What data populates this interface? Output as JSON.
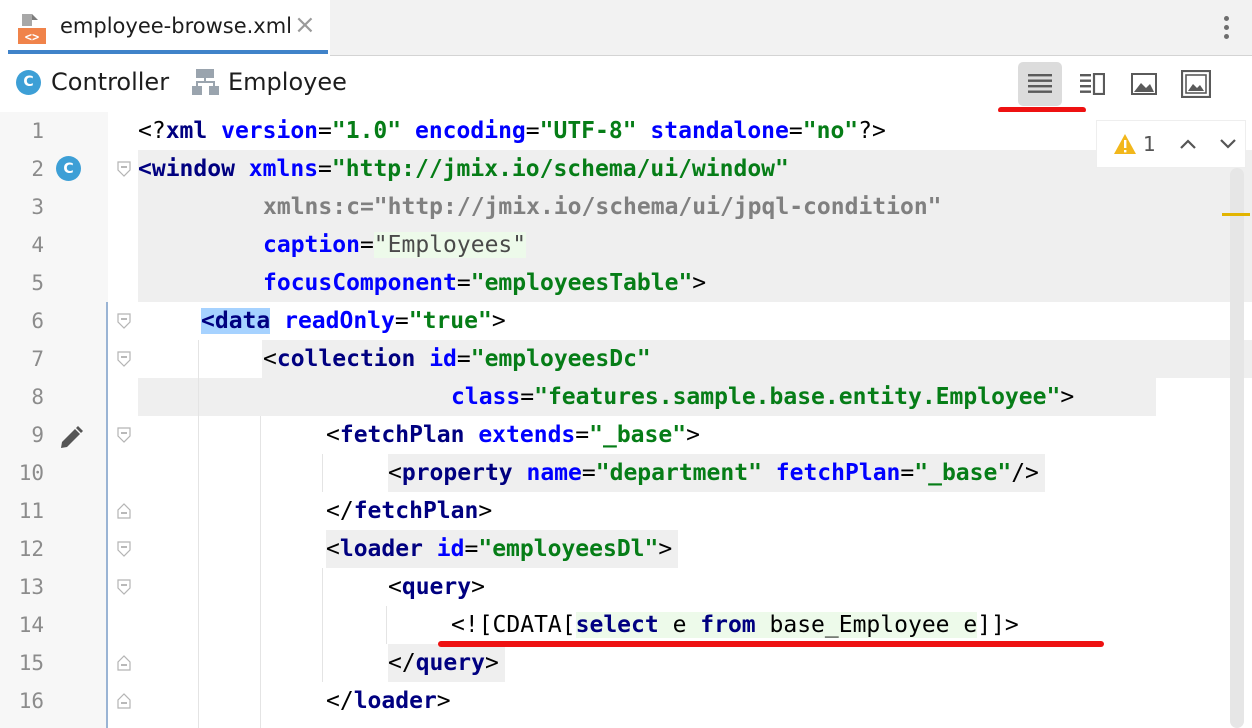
{
  "tab": {
    "title": "employee-browse.xml",
    "close_glyph": "×"
  },
  "toolbar": {
    "controller_label": "Controller",
    "controller_badge": "C",
    "entity_label": "Employee",
    "view_buttons": [
      "editor-only-icon",
      "editor-and-preview-icon",
      "preview-only-icon",
      "layout-preview-icon"
    ]
  },
  "inspection": {
    "warning_count": "1"
  },
  "gutter": {
    "class_badge": "C"
  },
  "code": {
    "line_numbers": [
      "1",
      "2",
      "3",
      "4",
      "5",
      "6",
      "7",
      "8",
      "9",
      "10",
      "11",
      "12",
      "13",
      "14",
      "15",
      "16"
    ],
    "l1": {
      "open": "<?",
      "tag": "xml",
      "attr1": " version",
      "eq1": "=",
      "val1": "\"1.0\"",
      "attr2": " encoding",
      "eq2": "=",
      "val2": "\"UTF-8\"",
      "attr3": " standalone",
      "eq3": "=",
      "val3": "\"no\"",
      "close": "?>"
    },
    "l2": {
      "lt": "<",
      "tag": "window",
      "attr": " xmlns",
      "eq": "=",
      "val": "\"http://jmix.io/schema/ui/window\""
    },
    "l3": {
      "attr": "xmlns:c",
      "eq": "=",
      "val": "\"http://jmix.io/schema/ui/jpql-condition\""
    },
    "l4": {
      "attr": "caption",
      "eq": "=",
      "val": "\"Employees\""
    },
    "l5": {
      "attr": "focusComponent",
      "eq": "=",
      "val": "\"employeesTable\"",
      "close": ">"
    },
    "l6": {
      "tag": "<data",
      "attr": " readOnly",
      "eq": "=",
      "val": "\"true\"",
      "close": ">"
    },
    "l7": {
      "lt": "<",
      "tag": "collection",
      "attr": " id",
      "eq": "=",
      "val": "\"employeesDc\""
    },
    "l8": {
      "attr": "class",
      "eq": "=",
      "val": "\"features.sample.base.entity.Employee\"",
      "close": ">"
    },
    "l9": {
      "lt": "<",
      "tag": "fetchPlan",
      "attr": " extends",
      "eq": "=",
      "val": "\"_base\"",
      "close": ">"
    },
    "l10": {
      "lt": "<",
      "tag": "property",
      "attr1": " name",
      "eq1": "=",
      "val1": "\"department\"",
      "attr2": " fetchPlan",
      "eq2": "=",
      "val2": "\"_base\"",
      "close": "/>"
    },
    "l11": {
      "lt": "</",
      "tag": "fetchPlan",
      "close": ">"
    },
    "l12": {
      "lt": "<",
      "tag": "loader",
      "attr": " id",
      "eq": "=",
      "val": "\"employeesDl\"",
      "close": ">"
    },
    "l13": {
      "lt": "<",
      "tag": "query",
      "close": ">"
    },
    "l14": {
      "open": "<![CDATA[",
      "kw1": "select",
      "mid1": " e ",
      "kw2": "from",
      "mid2": " base_Employee e",
      "close": "]]>"
    },
    "l15": {
      "lt": "</",
      "tag": "query",
      "close": ">"
    },
    "l16": {
      "lt": "</",
      "tag": "loader",
      "close": ">"
    }
  }
}
